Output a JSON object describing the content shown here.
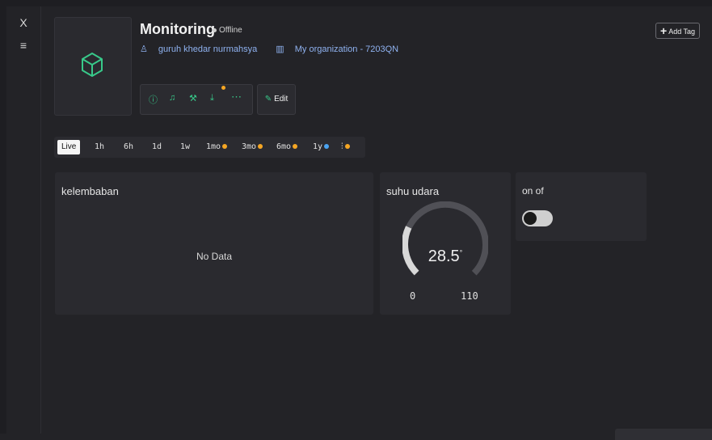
{
  "rail": {
    "close_label": "X",
    "menu_label": "≡"
  },
  "device": {
    "title": "Monitoring",
    "status": "Offline",
    "owner": "guruh khedar nurmahsya",
    "organization": "My organization - 7203QN",
    "owner_icon": "user-icon",
    "org_icon": "building-icon"
  },
  "actions": {
    "icons": [
      "info-icon",
      "bell-icon",
      "wrench-icon",
      "download-icon",
      "more-icon"
    ],
    "edit_label": "Edit",
    "add_tag_label": "Add Tag"
  },
  "time_ranges": {
    "live": "Live",
    "r1h": "1h",
    "r6h": "6h",
    "r1d": "1d",
    "r1w": "1w",
    "r1mo": "1mo",
    "r3mo": "3mo",
    "r6mo": "6mo",
    "r1y": "1y",
    "custom_icon": "sliders-icon"
  },
  "widgets": {
    "humidity": {
      "title": "kelembaban",
      "empty_text": "No Data"
    },
    "temperature": {
      "title": "suhu udara",
      "value": "28.5",
      "unit": "°",
      "min": "0",
      "max": "110",
      "level": 0.259
    },
    "switch": {
      "title": "on of",
      "state": "off"
    }
  },
  "colors": {
    "accent_green": "#38c98a",
    "badge_orange": "#f5a623",
    "badge_blue": "#4aa3f0",
    "link_blue": "#8fb2f0"
  }
}
